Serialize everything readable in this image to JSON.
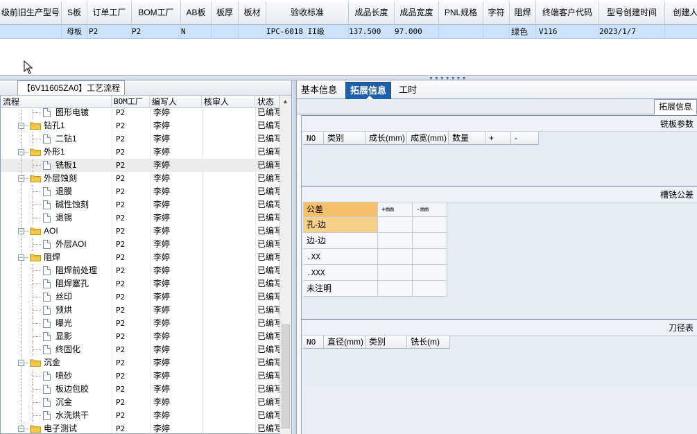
{
  "top_grid": {
    "headers": [
      "级前旧生产型号",
      "S板",
      "订单工厂",
      "BOM工厂",
      "AB板",
      "板厚",
      "板材",
      "验收标准",
      "成品长度",
      "成品宽度",
      "PNL规格",
      "字符",
      "阻焊",
      "终端客户代码",
      "型号创建时间",
      "创建人"
    ],
    "row": {
      "board_type": "母板",
      "order_factory": "P2",
      "bom_factory": "P2",
      "ab": "N",
      "standard": "IPC-6018 II级",
      "length": "137.500",
      "width": "97.000",
      "solder_mask": "绿色",
      "customer_code": "V116",
      "created": "2023/1/7"
    }
  },
  "left_panel": {
    "title": "【6V11605ZA0】工艺流程",
    "columns": [
      "流程",
      "BOM工厂",
      "编写人",
      "核审人",
      "状态"
    ],
    "rows": [
      {
        "level": 1,
        "kind": "doc",
        "name": "图形电镀",
        "factory": "P2",
        "writer": "李婷",
        "reviewer": "",
        "status": "已编写"
      },
      {
        "level": 0,
        "kind": "folder",
        "name": "钻孔1",
        "factory": "P2",
        "writer": "李婷",
        "reviewer": "",
        "status": "已编写"
      },
      {
        "level": 1,
        "kind": "doc",
        "name": "二钻1",
        "factory": "P2",
        "writer": "李婷",
        "reviewer": "",
        "status": "已编写"
      },
      {
        "level": 0,
        "kind": "folder",
        "name": "外形1",
        "factory": "P2",
        "writer": "李婷",
        "reviewer": "",
        "status": "已编写"
      },
      {
        "level": 1,
        "kind": "doc",
        "name": "铣板1",
        "factory": "P2",
        "writer": "李婷",
        "reviewer": "",
        "status": "已编写",
        "selected": true
      },
      {
        "level": 0,
        "kind": "folder",
        "name": "外层蚀刻",
        "factory": "P2",
        "writer": "李婷",
        "reviewer": "",
        "status": "已编写"
      },
      {
        "level": 1,
        "kind": "doc",
        "name": "退膜",
        "factory": "P2",
        "writer": "李婷",
        "reviewer": "",
        "status": "已编写"
      },
      {
        "level": 1,
        "kind": "doc",
        "name": "碱性蚀刻",
        "factory": "P2",
        "writer": "李婷",
        "reviewer": "",
        "status": "已编写"
      },
      {
        "level": 1,
        "kind": "doc",
        "name": "退锡",
        "factory": "P2",
        "writer": "李婷",
        "reviewer": "",
        "status": "已编写"
      },
      {
        "level": 0,
        "kind": "folder",
        "name": "AOI",
        "factory": "P2",
        "writer": "李婷",
        "reviewer": "",
        "status": "已编写"
      },
      {
        "level": 1,
        "kind": "doc",
        "name": "外层AOI",
        "factory": "P2",
        "writer": "李婷",
        "reviewer": "",
        "status": "已编写"
      },
      {
        "level": 0,
        "kind": "folder",
        "name": "阻焊",
        "factory": "P2",
        "writer": "李婷",
        "reviewer": "",
        "status": "已编写"
      },
      {
        "level": 1,
        "kind": "doc",
        "name": "阻焊前处理",
        "factory": "P2",
        "writer": "李婷",
        "reviewer": "",
        "status": "已编写"
      },
      {
        "level": 1,
        "kind": "doc",
        "name": "阻焊塞孔",
        "factory": "P2",
        "writer": "李婷",
        "reviewer": "",
        "status": "已编写"
      },
      {
        "level": 1,
        "kind": "doc",
        "name": "丝印",
        "factory": "P2",
        "writer": "李婷",
        "reviewer": "",
        "status": "已编写"
      },
      {
        "level": 1,
        "kind": "doc",
        "name": "预烘",
        "factory": "P2",
        "writer": "李婷",
        "reviewer": "",
        "status": "已编写"
      },
      {
        "level": 1,
        "kind": "doc",
        "name": "曝光",
        "factory": "P2",
        "writer": "李婷",
        "reviewer": "",
        "status": "已编写"
      },
      {
        "level": 1,
        "kind": "doc",
        "name": "显影",
        "factory": "P2",
        "writer": "李婷",
        "reviewer": "",
        "status": "已编写"
      },
      {
        "level": 1,
        "kind": "doc",
        "name": "终固化",
        "factory": "P2",
        "writer": "李婷",
        "reviewer": "",
        "status": "已编写"
      },
      {
        "level": 0,
        "kind": "folder",
        "name": "沉金",
        "factory": "P2",
        "writer": "李婷",
        "reviewer": "",
        "status": "已编写"
      },
      {
        "level": 1,
        "kind": "doc",
        "name": "喷砂",
        "factory": "P2",
        "writer": "李婷",
        "reviewer": "",
        "status": "已编写"
      },
      {
        "level": 1,
        "kind": "doc",
        "name": "板边包胶",
        "factory": "P2",
        "writer": "李婷",
        "reviewer": "",
        "status": "已编写"
      },
      {
        "level": 1,
        "kind": "doc",
        "name": "沉金",
        "factory": "P2",
        "writer": "李婷",
        "reviewer": "",
        "status": "已编写"
      },
      {
        "level": 1,
        "kind": "doc",
        "name": "水洗烘干",
        "factory": "P2",
        "writer": "李婷",
        "reviewer": "",
        "status": "已编写"
      },
      {
        "level": 0,
        "kind": "folder",
        "name": "电子测试",
        "factory": "P2",
        "writer": "李婷",
        "reviewer": "",
        "status": "已编写"
      }
    ]
  },
  "right_panel": {
    "tabs": [
      "基本信息",
      "拓展信息",
      "工时"
    ],
    "active_tab": 1,
    "sub_tab": "拓展信息",
    "milling_params": {
      "title": "铣板参数",
      "columns": [
        "NO",
        "类别",
        "成长(mm)",
        "成宽(mm)",
        "数量",
        "+",
        "-"
      ]
    },
    "slot_tolerance": {
      "title": "槽铣公差",
      "header": [
        "公差",
        "+mm",
        "-mm"
      ],
      "rows": [
        "孔-边",
        "边-边",
        ".XX",
        ".XXX",
        "未注明"
      ]
    },
    "tool_table": {
      "title": "刀径表",
      "columns": [
        "NO",
        "直径(mm)",
        "类别",
        "铣长(m)"
      ]
    }
  },
  "colors": {
    "selected_row": "#cde3fb",
    "active_tab": "#1f5ea8",
    "tolerance_highlight": "#f5c06a"
  }
}
